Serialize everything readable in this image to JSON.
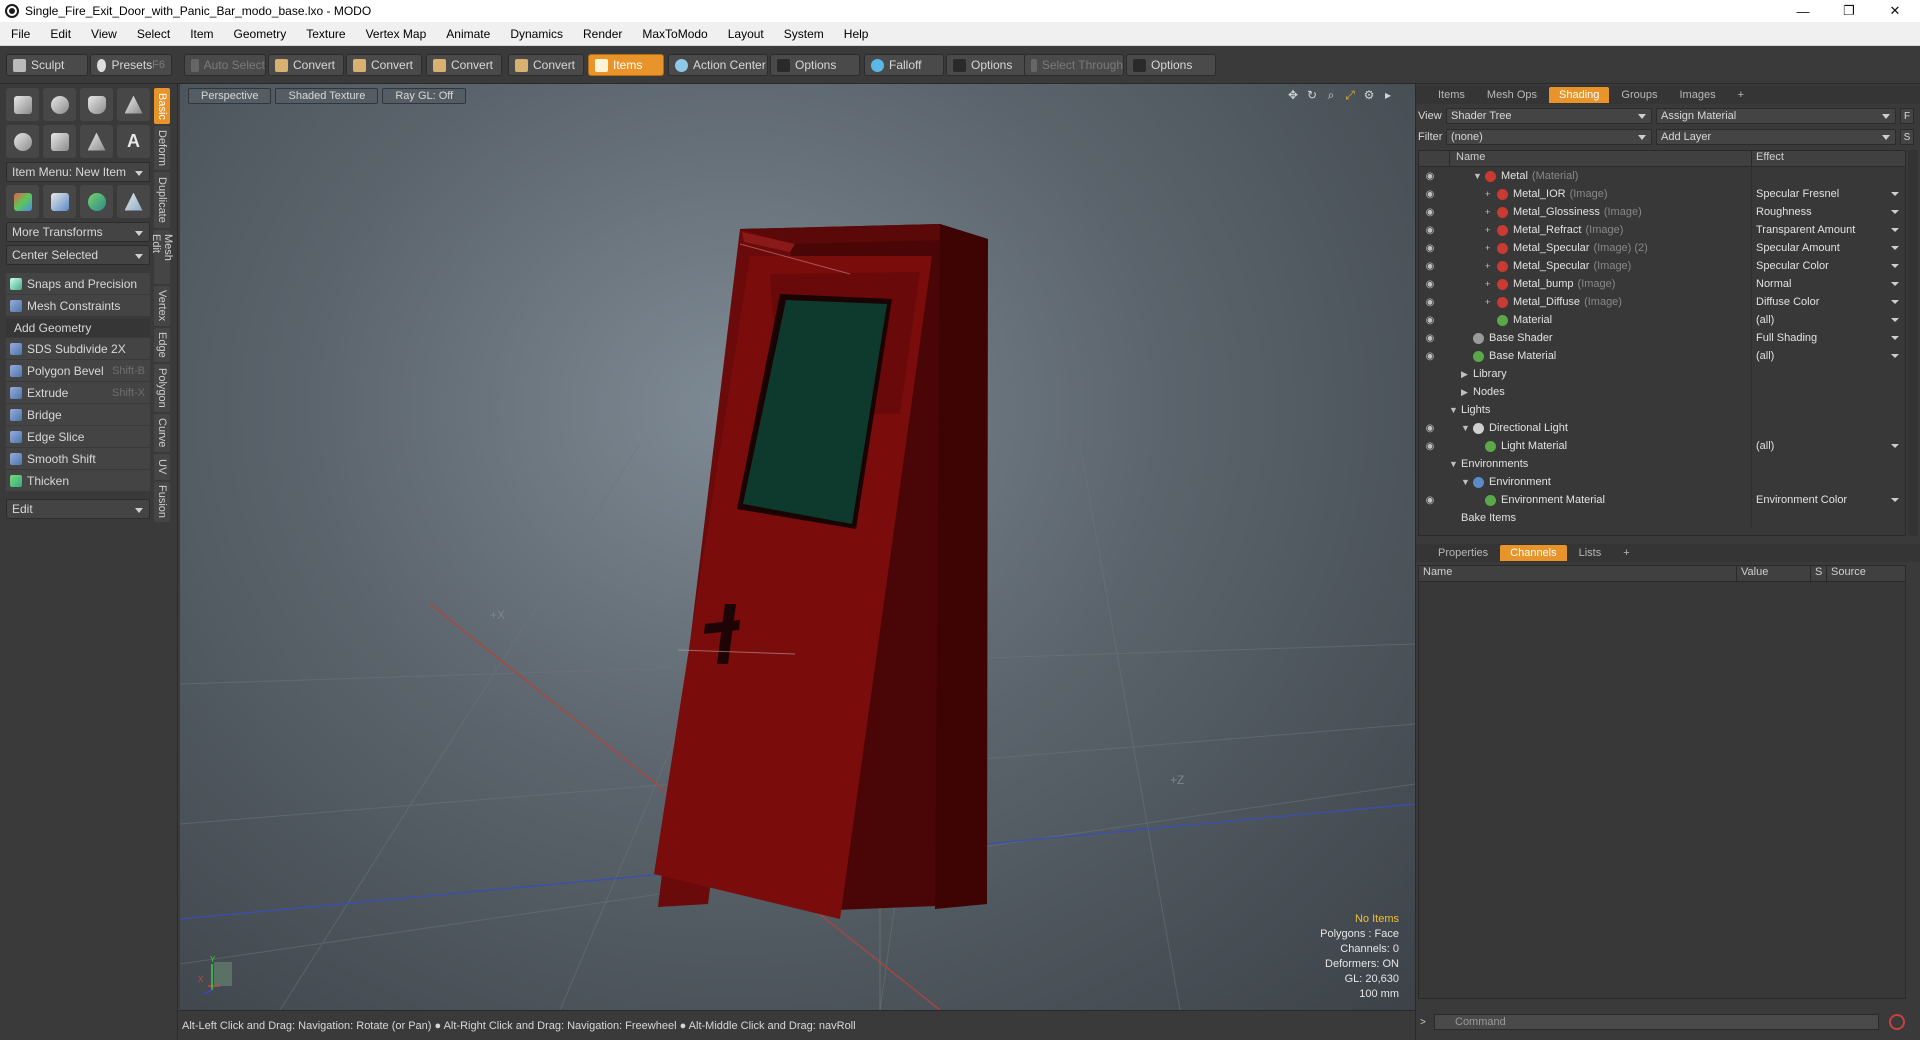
{
  "window": {
    "title": "Single_Fire_Exit_Door_with_Panic_Bar_modo_base.lxo - MODO",
    "minimize": "—",
    "maximize": "❐",
    "close": "✕"
  },
  "menu": [
    "File",
    "Edit",
    "View",
    "Select",
    "Item",
    "Geometry",
    "Texture",
    "Vertex Map",
    "Animate",
    "Dynamics",
    "Render",
    "MaxToModo",
    "Layout",
    "System",
    "Help"
  ],
  "toolbar": {
    "sculpt": "Sculpt",
    "presets": "Presets",
    "presets_key": "F6",
    "auto_select": "Auto Select",
    "convert1": "Convert",
    "convert2": "Convert",
    "convert3": "Convert",
    "convert4": "Convert",
    "items": "Items",
    "action_center": "Action Center",
    "options1": "Options",
    "falloff": "Falloff",
    "options2": "Options",
    "select_through": "Select Through",
    "options3": "Options"
  },
  "left": {
    "item_menu": "Item Menu: New Item",
    "more_transforms": "More Transforms",
    "center_selected": "Center Selected",
    "snaps": "Snaps and Precision",
    "mesh_constraints": "Mesh Constraints",
    "add_geometry": "Add Geometry",
    "tools": [
      {
        "label": "SDS Subdivide 2X",
        "key": ""
      },
      {
        "label": "Polygon Bevel",
        "key": "Shift-B"
      },
      {
        "label": "Extrude",
        "key": "Shift-X"
      },
      {
        "label": "Bridge",
        "key": ""
      },
      {
        "label": "Edge Slice",
        "key": ""
      },
      {
        "label": "Smooth Shift",
        "key": ""
      },
      {
        "label": "Thicken",
        "key": ""
      }
    ],
    "edit": "Edit",
    "vtabs": [
      "Basic",
      "Deform",
      "Duplicate",
      "Mesh Edit",
      "Vertex",
      "Edge",
      "Polygon",
      "Curve",
      "UV",
      "Fusion"
    ]
  },
  "viewport": {
    "tabs": [
      "Perspective",
      "Shaded Texture",
      "Ray GL: Off"
    ],
    "stats": {
      "items": "No Items",
      "polygons": "Polygons : Face",
      "channels": "Channels: 0",
      "deformers": "Deformers: ON",
      "gl": "GL: 20,630",
      "size": "100 mm"
    },
    "axis_x": "X",
    "axis_y": "Y",
    "axis_z": "Z",
    "plus1": "+X",
    "plus2": "+Z"
  },
  "statusbar": "Alt-Left Click and Drag: Navigation: Rotate (or Pan) ● Alt-Right Click and Drag: Navigation: Freewheel ● Alt-Middle Click and Drag: navRoll",
  "shading": {
    "tabs": [
      "Items",
      "Mesh Ops",
      "Shading",
      "Groups",
      "Images",
      "+"
    ],
    "view_label": "View",
    "view_value": "Shader Tree",
    "assign": "Assign Material",
    "f": "F",
    "filter_label": "Filter",
    "filter_value": "(none)",
    "add_layer": "Add Layer",
    "s": "S",
    "col_name": "Name",
    "col_effect": "Effect",
    "rows": [
      {
        "depth": 2,
        "toggle": "▼",
        "name": "Metal",
        "sub": "(Material)",
        "effect": "",
        "color": "#c83a32",
        "eye": true
      },
      {
        "depth": 3,
        "toggle": "+",
        "name": "Metal_IOR",
        "sub": "(Image)",
        "effect": "Specular Fresnel",
        "color": "#c83a32",
        "eye": true
      },
      {
        "depth": 3,
        "toggle": "+",
        "name": "Metal_Glossiness",
        "sub": "(Image)",
        "effect": "Roughness",
        "color": "#c83a32",
        "eye": true
      },
      {
        "depth": 3,
        "toggle": "+",
        "name": "Metal_Refract",
        "sub": "(Image)",
        "effect": "Transparent Amount",
        "color": "#c83a32",
        "eye": true
      },
      {
        "depth": 3,
        "toggle": "+",
        "name": "Metal_Specular",
        "sub": "(Image) (2)",
        "effect": "Specular Amount",
        "color": "#c83a32",
        "eye": true
      },
      {
        "depth": 3,
        "toggle": "+",
        "name": "Metal_Specular",
        "sub": "(Image)",
        "effect": "Specular Color",
        "color": "#c83a32",
        "eye": true
      },
      {
        "depth": 3,
        "toggle": "+",
        "name": "Metal_bump",
        "sub": "(Image)",
        "effect": "Normal",
        "color": "#c83a32",
        "eye": true
      },
      {
        "depth": 3,
        "toggle": "+",
        "name": "Metal_Diffuse",
        "sub": "(Image)",
        "effect": "Diffuse Color",
        "color": "#c83a32",
        "eye": true
      },
      {
        "depth": 3,
        "toggle": "",
        "name": "Material",
        "sub": "",
        "effect": "(all)",
        "color": "#5aa84a",
        "eye": true
      },
      {
        "depth": 1,
        "toggle": "",
        "name": "Base Shader",
        "sub": "",
        "effect": "Full Shading",
        "color": "#9a9a9a",
        "eye": true
      },
      {
        "depth": 1,
        "toggle": "",
        "name": "Base Material",
        "sub": "",
        "effect": "(all)",
        "color": "#5aa84a",
        "eye": true
      },
      {
        "depth": 1,
        "toggle": "▶",
        "name": "Library",
        "sub": "",
        "effect": "",
        "color": "",
        "eye": false
      },
      {
        "depth": 1,
        "toggle": "▶",
        "name": "Nodes",
        "sub": "",
        "effect": "",
        "color": "",
        "eye": false
      },
      {
        "depth": 0,
        "toggle": "▼",
        "name": "Lights",
        "sub": "",
        "effect": "",
        "color": "",
        "eye": false
      },
      {
        "depth": 1,
        "toggle": "▼",
        "name": "Directional Light",
        "sub": "",
        "effect": "",
        "color": "#d0d0d0",
        "eye": true
      },
      {
        "depth": 2,
        "toggle": "",
        "name": "Light Material",
        "sub": "",
        "effect": "(all)",
        "color": "#5aa84a",
        "eye": true
      },
      {
        "depth": 0,
        "toggle": "▼",
        "name": "Environments",
        "sub": "",
        "effect": "",
        "color": "",
        "eye": false
      },
      {
        "depth": 1,
        "toggle": "▼",
        "name": "Environment",
        "sub": "",
        "effect": "",
        "color": "#5a8ac8",
        "eye": false
      },
      {
        "depth": 2,
        "toggle": "",
        "name": "Environment Material",
        "sub": "",
        "effect": "Environment Color",
        "color": "#5aa84a",
        "eye": true
      },
      {
        "depth": 0,
        "toggle": "",
        "name": "Bake Items",
        "sub": "",
        "effect": "",
        "color": "",
        "eye": false
      }
    ]
  },
  "properties": {
    "tabs": [
      "Properties",
      "Channels",
      "Lists",
      "+"
    ],
    "col_name": "Name",
    "col_value": "Value",
    "col_s": "S",
    "col_source": "Source"
  },
  "command": {
    "placeholder": "Command"
  },
  "colors": {
    "accent": "#e8942a",
    "door": "#7a0c0c",
    "glass": "#0e3a2e"
  }
}
